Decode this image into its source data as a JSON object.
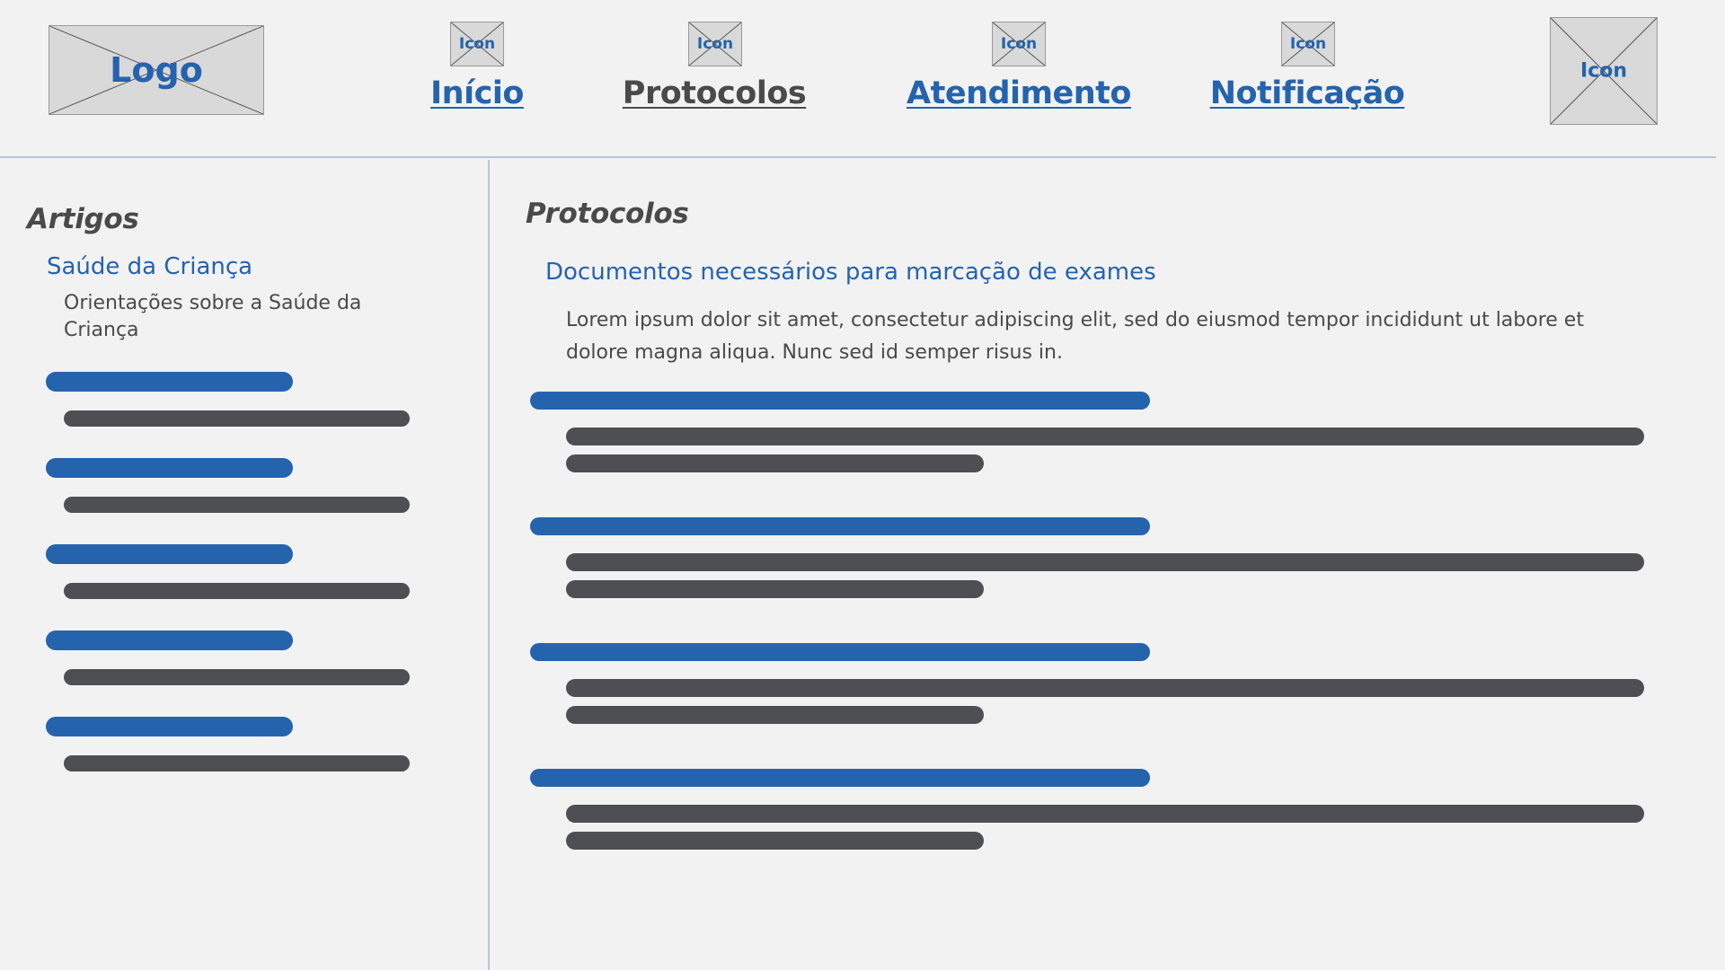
{
  "header": {
    "logo_label": "Logo",
    "nav": [
      {
        "label": "Início",
        "icon_label": "Icon",
        "color": "#2563ad"
      },
      {
        "label": "Protocolos",
        "icon_label": "Icon",
        "color": "#4a4a4a"
      },
      {
        "label": "Atendimento",
        "icon_label": "Icon",
        "color": "#2563ad"
      },
      {
        "label": "Notificação",
        "icon_label": "Icon",
        "color": "#2563ad"
      }
    ],
    "profile_icon_label": "Icon"
  },
  "sidebar": {
    "title": "Artigos",
    "article": {
      "title": "Saúde da Criança",
      "description": "Orientações sobre a Saúde da Criança"
    }
  },
  "main": {
    "title": "Protocolos",
    "protocol": {
      "title": "Documentos necessários para marcação de exames",
      "text": "Lorem ipsum dolor sit amet, consectetur adipiscing elit, sed do eiusmod tempor incididunt ut labore et dolore magna aliqua. Nunc sed id semper risus in."
    }
  },
  "colors": {
    "accent": "#2563ad",
    "text_dark": "#4a4a4a",
    "bar_dark": "#4e4f53",
    "background": "#f2f2f2",
    "placeholder": "#d9d9d9",
    "divider": "#b7c6d9"
  }
}
